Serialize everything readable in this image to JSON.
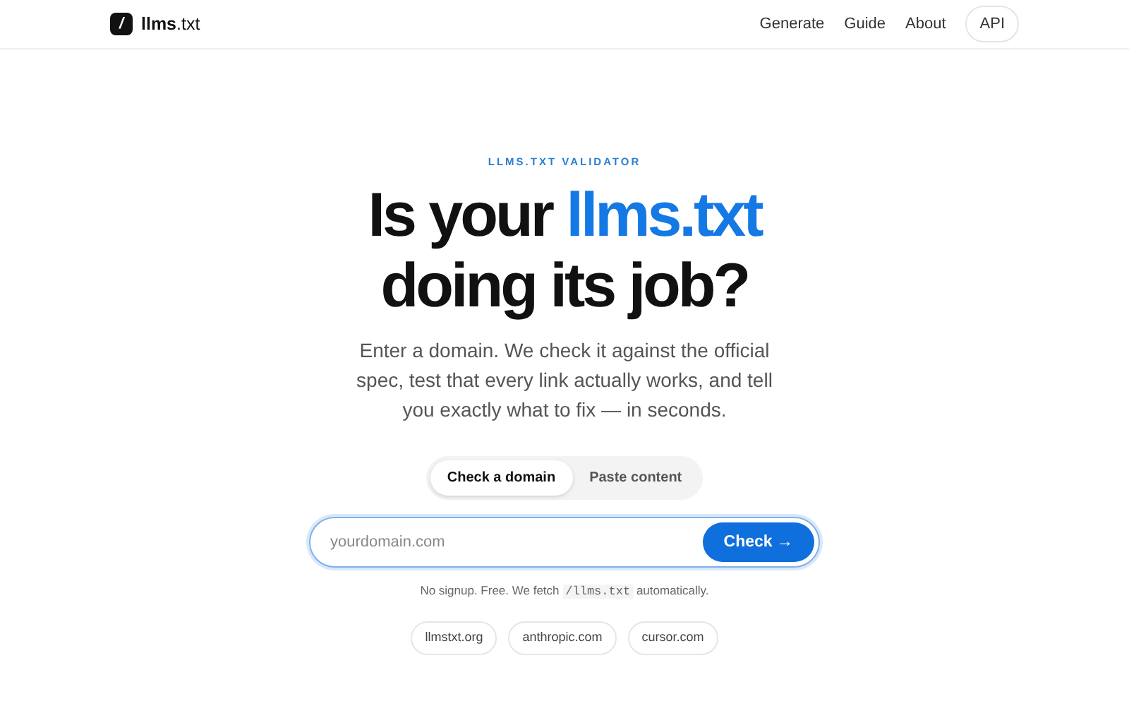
{
  "header": {
    "logo_mark": "/",
    "logo_text": "**llms**.txt",
    "nav": [
      {
        "label": "Generate",
        "kind": "link"
      },
      {
        "label": "Guide",
        "kind": "link"
      },
      {
        "label": "About",
        "kind": "link"
      },
      {
        "label": "API",
        "kind": "pill"
      }
    ]
  },
  "hero": {
    "eyebrow": "LLMS.TXT VALIDATOR",
    "title_start": "Is your",
    "title_highlight": "llms.txt",
    "title_end": "doing its job?",
    "description": "Enter a domain. We check it against the official spec, test that every link actually works, and tell you exactly what to fix — in seconds."
  },
  "tabs": [
    {
      "label": "Check a domain",
      "selected": true
    },
    {
      "label": "Paste content",
      "selected": false
    }
  ],
  "search": {
    "placeholder": "yourdomain.com",
    "button": "Check →"
  },
  "note": {
    "before": "No signup. Free. We fetch",
    "code": "/llms.txt",
    "after": "automatically."
  },
  "examples": [
    "llmstxt.org",
    "anthropic.com",
    "cursor.com"
  ]
}
